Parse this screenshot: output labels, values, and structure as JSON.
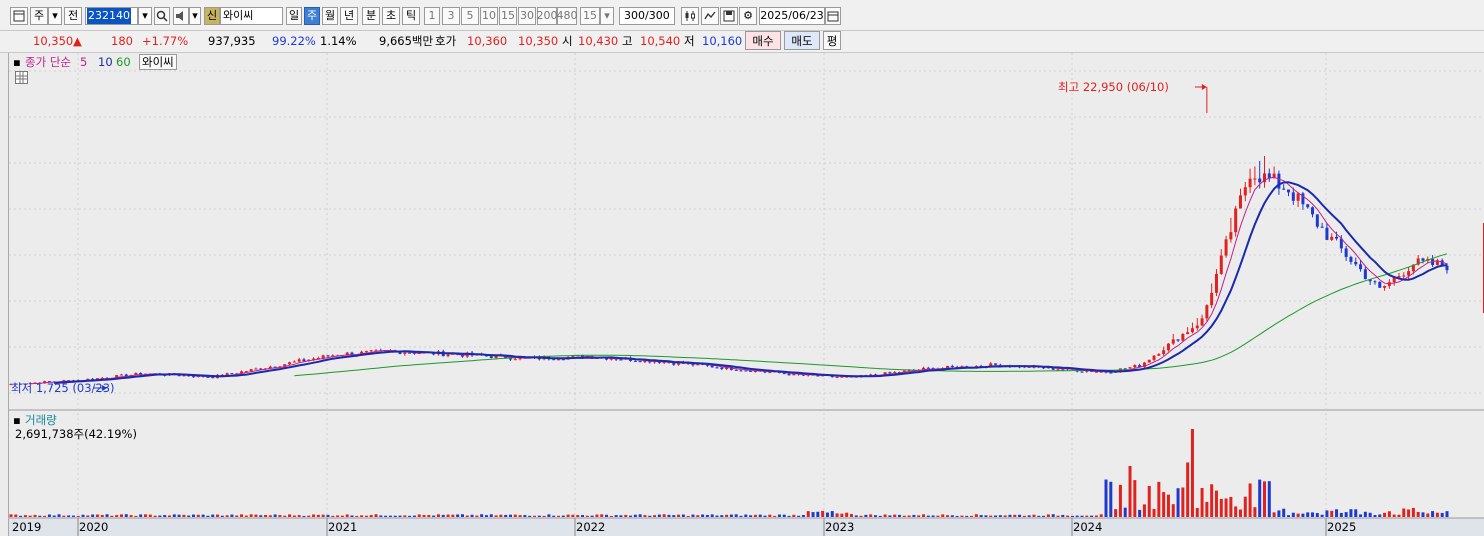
{
  "toolbar": {
    "period_label": "주",
    "all_label": "전",
    "stock_code": "232140",
    "sin_label": "신",
    "stock_name": "와이씨",
    "period_tabs": [
      "일",
      "주",
      "월",
      "년",
      "분",
      "초",
      "틱"
    ],
    "active_period": "주",
    "minute_options": [
      "1",
      "3",
      "5",
      "10",
      "15",
      "30",
      "200",
      "480"
    ],
    "interval_value": "15",
    "count_value": "300",
    "count_total": "/300",
    "date_value": "2025/06/23"
  },
  "quote": {
    "price": "10,350",
    "change": "180",
    "change_rate": "+1.77%",
    "volume": "937,935",
    "vol_ratio": "99.22%",
    "turnover": "1.14%",
    "trade_amount": "9,665백만",
    "hoga_label": "호가",
    "ask": "10,360",
    "bid": "10,350",
    "open_label": "시",
    "open": "10,430",
    "high_label": "고",
    "high": "10,540",
    "low_label": "저",
    "low": "10,160",
    "buy_label": "매수",
    "sell_label": "매도",
    "avg_label": "평"
  },
  "price_panel": {
    "legend": {
      "title": "종가 단순",
      "ma": [
        "5",
        "10",
        "60"
      ],
      "name": "와이씨"
    },
    "max_label": "최고 22,950 (06/10)",
    "min_label": "최저 1,725 (03/23)"
  },
  "volume_panel": {
    "legend": "거래량",
    "value": "2,691,738주(42.19%)"
  },
  "x_axis": [
    "2019",
    "2020",
    "2021",
    "2022",
    "2023",
    "2024",
    "2025"
  ],
  "colors": {
    "up": "#e0221f",
    "down": "#1d3ad0",
    "ma5": "#c0208c",
    "ma10": "#1a2aa8",
    "ma60": "#1a9a2a",
    "accent": "#3d7fd6"
  },
  "chart_data": [
    {
      "type": "candlestick",
      "series": [
        {
          "name": "5",
          "values": []
        },
        {
          "name": "10",
          "values": []
        },
        {
          "name": "60",
          "values": []
        }
      ],
      "x": [
        "2019/12",
        "2020/03",
        "2020/06",
        "2020/09",
        "2020/12",
        "2021/03",
        "2021/06",
        "2021/09",
        "2021/12",
        "2022/03",
        "2022/06",
        "2022/09",
        "2022/12",
        "2023/03",
        "2023/06",
        "2023/09",
        "2023/12",
        "2024/02",
        "2024/03",
        "2024/04",
        "2024/06",
        "2024/08",
        "2024/10",
        "2024/12",
        "2025/03",
        "2025/06"
      ],
      "close": [
        2000,
        2300,
        2750,
        2500,
        3300,
        4100,
        4300,
        4050,
        3800,
        3950,
        3600,
        3100,
        2600,
        2450,
        3050,
        3350,
        2850,
        3300,
        5000,
        6500,
        17000,
        15700,
        12500,
        8600,
        10500,
        10350
      ],
      "max": {
        "label": "최고",
        "value": 22950,
        "date": "06/10"
      },
      "min": {
        "label": "최저",
        "value": 1725,
        "date": "03/23"
      }
    },
    {
      "type": "bar",
      "title": "거래량",
      "note": "weekly volume bars"
    }
  ]
}
